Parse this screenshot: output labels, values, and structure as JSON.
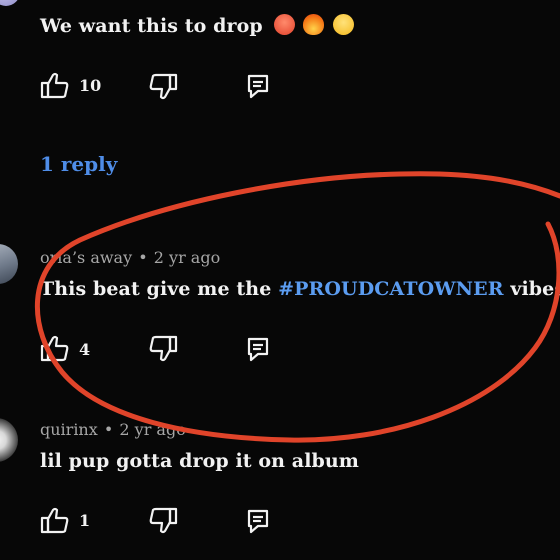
{
  "comments": [
    {
      "text": "We want this to drop",
      "emojis": [
        "hot-face-emoji",
        "fire-emoji",
        "star-struck-emoji"
      ],
      "likes": "10"
    },
    {
      "author": "oria’s away",
      "separator": "•",
      "time": "2 yr ago",
      "text_before": "This beat give me the ",
      "hashtag": "#PROUDCATOWNER",
      "text_after": " vibes",
      "likes": "4"
    },
    {
      "author": "quirinx",
      "separator": "•",
      "time": "2 yr ago",
      "text": "lil pup gotta drop it on album",
      "likes": "1"
    }
  ],
  "replies_link": "1 reply",
  "colors": {
    "background": "#070707",
    "link": "#4f8de8",
    "annotation": "#e0442a"
  },
  "icons": [
    "thumbs-up-icon",
    "thumbs-down-icon",
    "reply-icon"
  ]
}
